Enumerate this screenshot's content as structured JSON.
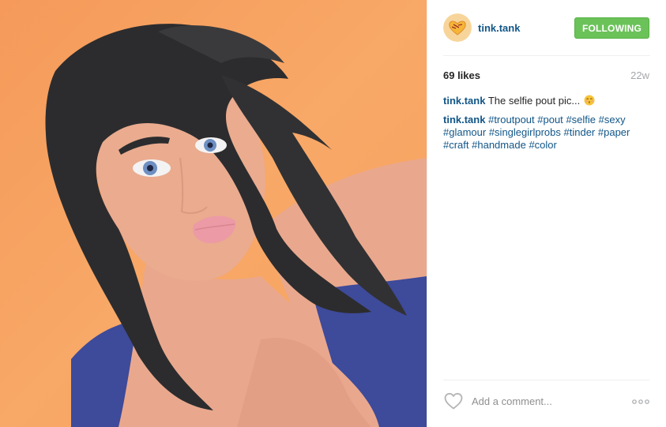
{
  "post": {
    "username": "tink.tank",
    "follow_label": "FOLLOWING",
    "likes": "69 likes",
    "age": "22w",
    "caption": {
      "user": "tink.tank",
      "text": "The selfie pout pic...",
      "emoji": "kissing-face-icon"
    },
    "hashtags_comment": {
      "user": "tink.tank",
      "tags": [
        "#troutpout",
        "#pout",
        "#selfie",
        "#sexy",
        "#glamour",
        "#singlegirlprobs",
        "#tinder",
        "#paper",
        "#craft",
        "#handmade",
        "#color"
      ]
    },
    "comment_placeholder": "Add a comment...",
    "icons": {
      "like": "heart-outline-icon",
      "more": "more-options-icon",
      "avatar": "paper-heart-avatar"
    },
    "colors": {
      "accent_link": "#125688",
      "follow_button": "#6bc259",
      "muted": "#a5a7aa"
    }
  }
}
